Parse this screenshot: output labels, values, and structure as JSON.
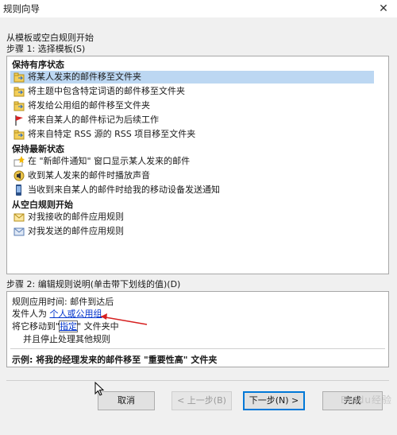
{
  "window": {
    "title": "规则向导",
    "close_glyph": "✕"
  },
  "hint_line1": "从模板或空白规则开始",
  "step1_label": "步骤 1: 选择模板(S)",
  "groups": [
    {
      "header": "保持有序状态",
      "items": [
        {
          "label": "将某人发来的邮件移至文件夹",
          "icon": "move-folder-icon",
          "selected": true
        },
        {
          "label": "将主题中包含特定词语的邮件移至文件夹",
          "icon": "move-folder-icon"
        },
        {
          "label": "将发给公用组的邮件移至文件夹",
          "icon": "move-folder-icon"
        },
        {
          "label": "将来自某人的邮件标记为后续工作",
          "icon": "red-flag-icon"
        },
        {
          "label": "将来自特定 RSS 源的 RSS 项目移至文件夹",
          "icon": "move-folder-icon"
        }
      ]
    },
    {
      "header": "保持最新状态",
      "items": [
        {
          "label": "在 \"新邮件通知\" 窗口显示某人发来的邮件",
          "icon": "notify-star-icon"
        },
        {
          "label": "收到某人发来的邮件时播放声音",
          "icon": "speaker-icon"
        },
        {
          "label": "当收到来自某人的邮件时给我的移动设备发送通知",
          "icon": "mobile-device-icon"
        }
      ]
    },
    {
      "header": "从空白规则开始",
      "items": [
        {
          "label": "对我接收的邮件应用规则",
          "icon": "envelope-icon"
        },
        {
          "label": "对我发送的邮件应用规则",
          "icon": "sent-mail-icon"
        }
      ]
    }
  ],
  "step2_label": "步骤 2: 编辑规则说明(单击带下划线的值)(D)",
  "desc": {
    "line1": "规则应用时间: 邮件到达后",
    "line2_prefix": "发件人为",
    "line2_link": "个人或公用组",
    "line3_prefix": "将它移动到\"",
    "line3_link": "指定",
    "line3_suffix": "\" 文件夹中",
    "line4": "并且停止处理其他规则"
  },
  "example": "示例: 将我的经理发来的邮件移至 \"重要性高\" 文件夹",
  "buttons": {
    "cancel": "取消",
    "back": "< 上一步(B)",
    "next": "下一步(N) >",
    "finish": "完成"
  },
  "watermark": "Baidu经验",
  "colors": {
    "selection": "#bcd7f2",
    "link": "#0033cc",
    "arrow": "#d62020"
  }
}
